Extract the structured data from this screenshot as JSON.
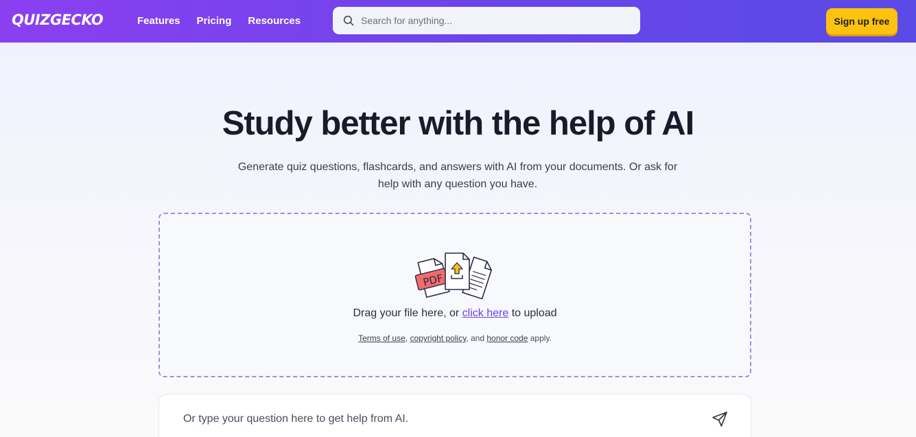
{
  "nav": {
    "logo": "QUIZGECKO",
    "links": [
      "Features",
      "Pricing",
      "Resources"
    ],
    "search_placeholder": "Search for anything...",
    "signup_label": "Sign up free"
  },
  "hero": {
    "title": "Study better with the help of AI",
    "subtitle": "Generate quiz questions, flashcards, and answers with AI from your documents. Or ask for help with any question you have."
  },
  "upload": {
    "illustration_label": "PDF",
    "drag_prefix": "Drag your file here, or",
    "click_here": "click here",
    "drag_suffix": "to upload",
    "legal": {
      "terms": "Terms of use",
      "comma": ",",
      "copyright": "copyright policy",
      "and": ", and",
      "honor": "honor code",
      "apply": "apply."
    }
  },
  "question": {
    "placeholder": "Or type your question here to get help from AI."
  },
  "colors": {
    "nav_gradient_start": "#8b3ff0",
    "nav_gradient_end": "#5a4ae6",
    "signup_bg": "#ffc20e",
    "link_accent": "#6a3fe8",
    "dropzone_border": "#a38ce0"
  },
  "icons": {
    "search": "search-icon",
    "upload": "upload-file-illustration",
    "send": "send-icon"
  }
}
